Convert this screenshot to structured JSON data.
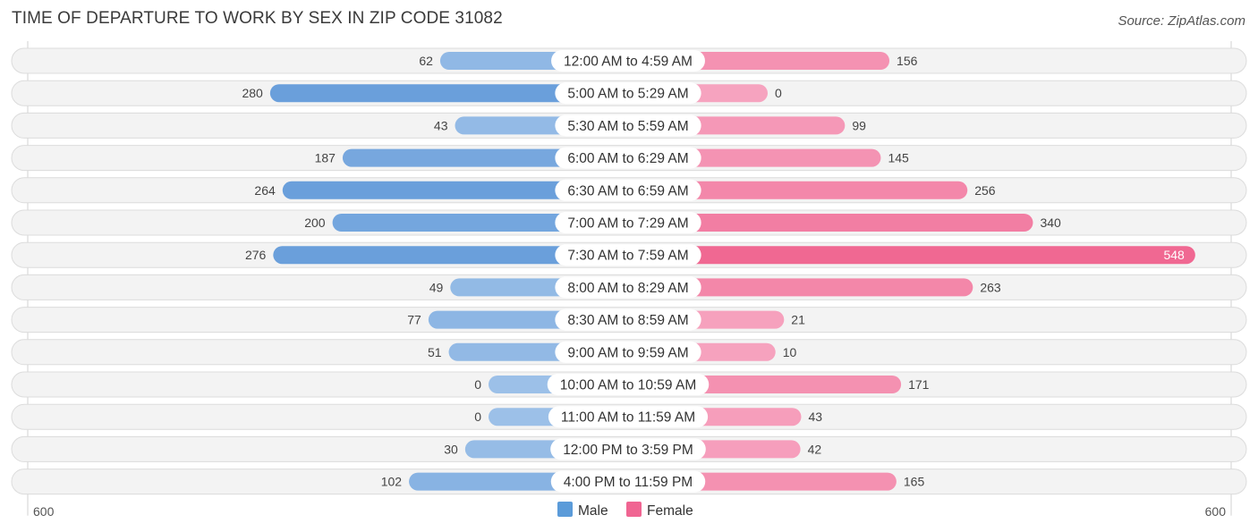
{
  "header": {
    "title": "TIME OF DEPARTURE TO WORK BY SEX IN ZIP CODE 31082",
    "source": "Source: ZipAtlas.com"
  },
  "colors": {
    "male_strong": "#6a9fdb",
    "male_light": "#9cc0e8",
    "female_strong": "#f06892",
    "female_light": "#f6a3bf",
    "legend_male": "#5b9bd9",
    "legend_female": "#f06592"
  },
  "chart_data": {
    "type": "bar",
    "orientation": "horizontal-diverging",
    "title": "TIME OF DEPARTURE TO WORK BY SEX IN ZIP CODE 31082",
    "categories": [
      "12:00 AM to 4:59 AM",
      "5:00 AM to 5:29 AM",
      "5:30 AM to 5:59 AM",
      "6:00 AM to 6:29 AM",
      "6:30 AM to 6:59 AM",
      "7:00 AM to 7:29 AM",
      "7:30 AM to 7:59 AM",
      "8:00 AM to 8:29 AM",
      "8:30 AM to 8:59 AM",
      "9:00 AM to 9:59 AM",
      "10:00 AM to 10:59 AM",
      "11:00 AM to 11:59 AM",
      "12:00 PM to 3:59 PM",
      "4:00 PM to 11:59 PM"
    ],
    "series": [
      {
        "name": "Male",
        "values": [
          62,
          280,
          43,
          187,
          264,
          200,
          276,
          49,
          77,
          51,
          0,
          0,
          30,
          102
        ]
      },
      {
        "name": "Female",
        "values": [
          156,
          0,
          99,
          145,
          256,
          340,
          548,
          263,
          21,
          10,
          171,
          43,
          42,
          165
        ]
      }
    ],
    "axis": {
      "left_label": "600",
      "right_label": "600",
      "max": 600
    },
    "legend": {
      "position": "bottom-center",
      "entries": [
        "Male",
        "Female"
      ]
    },
    "xlabel": "",
    "ylabel": ""
  }
}
